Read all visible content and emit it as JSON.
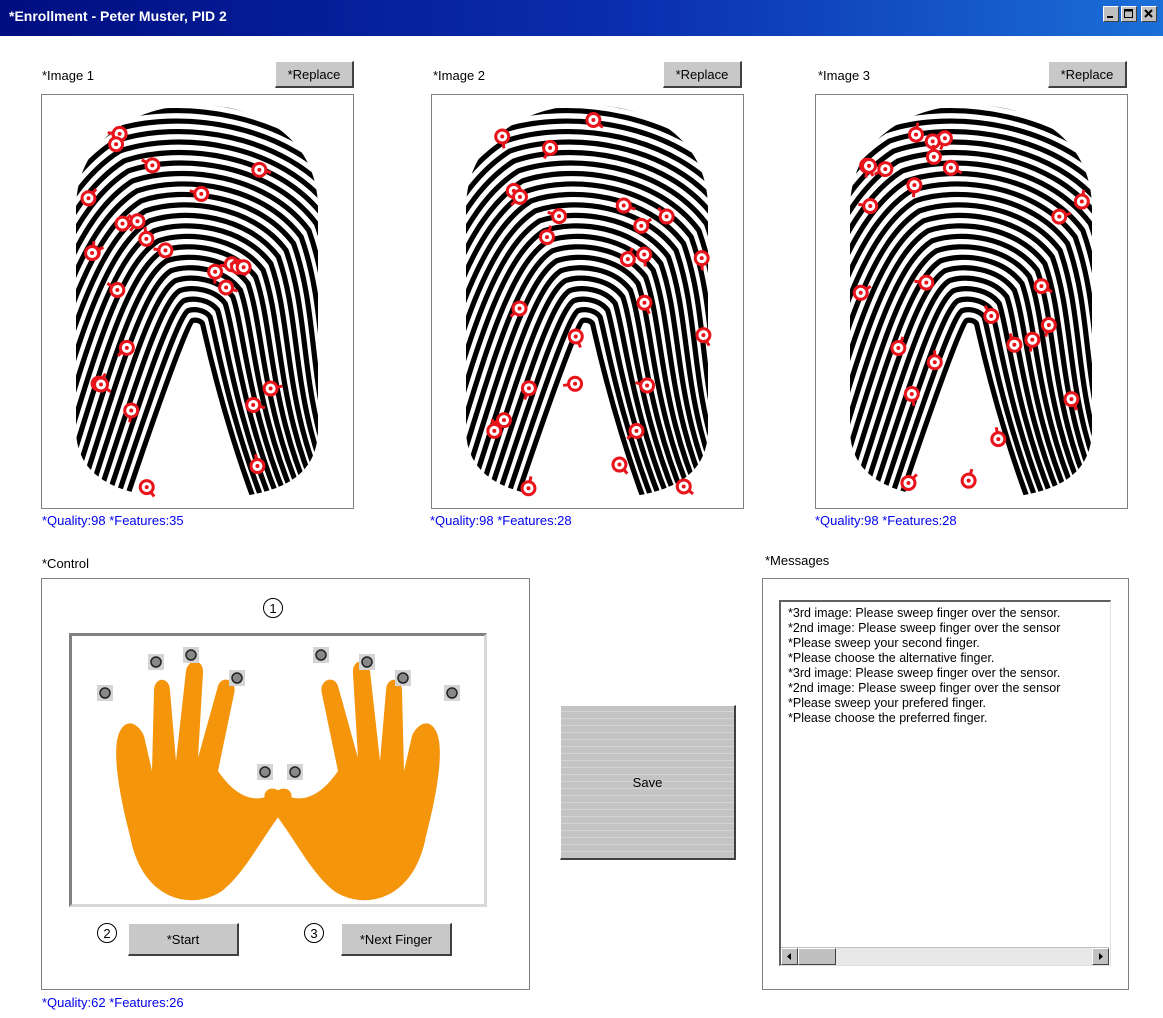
{
  "window": {
    "title": "*Enrollment - Peter Muster, PID 2"
  },
  "images": [
    {
      "label": "*Image 1",
      "replace_label": "*Replace",
      "status": "*Quality:98 *Features:35",
      "seed": 11
    },
    {
      "label": "*Image 2",
      "replace_label": "*Replace",
      "status": "*Quality:98 *Features:28",
      "seed": 27
    },
    {
      "label": "*Image 3",
      "replace_label": "*Replace",
      "status": "*Quality:98 *Features:28",
      "seed": 43
    }
  ],
  "control": {
    "label": "*Control",
    "step1": "1",
    "step2": "2",
    "step3": "3",
    "start_label": "*Start",
    "next_finger_label": "*Next Finger",
    "status": "*Quality:62 *Features:26",
    "hand_color": "#f4950b"
  },
  "save": {
    "label": "Save"
  },
  "messages": {
    "label": "*Messages",
    "items": [
      "*3rd image: Please sweep finger over the sensor.",
      "*2nd image: Please sweep finger over the sensor",
      "*Please sweep your second finger.",
      "*Please choose the alternative finger.",
      "*3rd image: Please sweep finger over the sensor.",
      "*2nd image: Please sweep finger over the sensor",
      "*Please sweep your prefered finger.",
      "*Please choose the preferred finger."
    ]
  },
  "colors": {
    "minutia": "#e8141c",
    "status_text": "#0000ee",
    "title_bar": "#0a2fb0"
  }
}
